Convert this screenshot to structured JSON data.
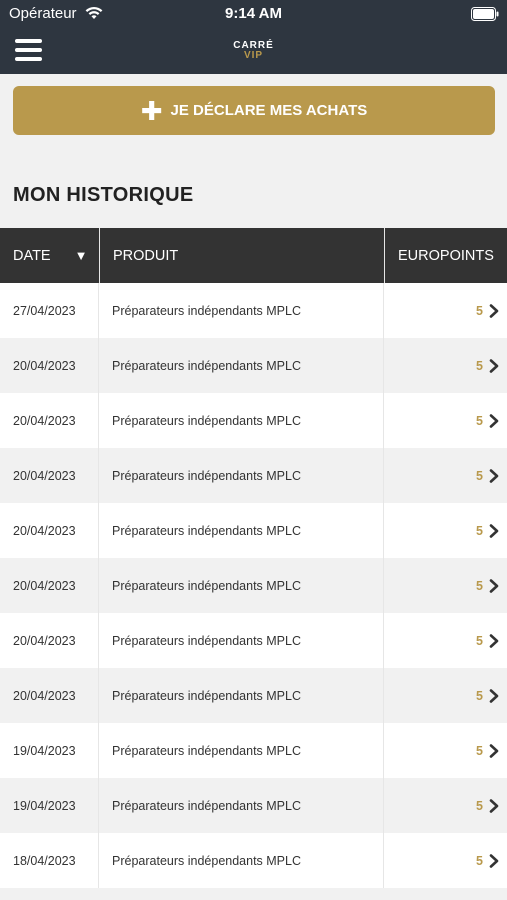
{
  "status_bar": {
    "carrier": "Opérateur",
    "time": "9:14 AM"
  },
  "header": {
    "logo_line1": "CARRÉ",
    "logo_line2": "VIP",
    "menu_icon": "hamburger-menu-icon"
  },
  "cta": {
    "icon": "plus-icon",
    "label": "JE DÉCLARE MES ACHATS"
  },
  "section_title": "MON HISTORIQUE",
  "table": {
    "columns": [
      "DATE",
      "PRODUIT",
      "EUROPOINTS"
    ],
    "sort_icon": "sort-down-triangle-icon",
    "rows": [
      {
        "date": "27/04/2023",
        "product": "Préparateurs indépendants MPLC",
        "points": "5"
      },
      {
        "date": "20/04/2023",
        "product": "Préparateurs indépendants MPLC",
        "points": "5"
      },
      {
        "date": "20/04/2023",
        "product": "Préparateurs indépendants MPLC",
        "points": "5"
      },
      {
        "date": "20/04/2023",
        "product": "Préparateurs indépendants MPLC",
        "points": "5"
      },
      {
        "date": "20/04/2023",
        "product": "Préparateurs indépendants MPLC",
        "points": "5"
      },
      {
        "date": "20/04/2023",
        "product": "Préparateurs indépendants MPLC",
        "points": "5"
      },
      {
        "date": "20/04/2023",
        "product": "Préparateurs indépendants MPLC",
        "points": "5"
      },
      {
        "date": "20/04/2023",
        "product": "Préparateurs indépendants MPLC",
        "points": "5"
      },
      {
        "date": "19/04/2023",
        "product": "Préparateurs indépendants MPLC",
        "points": "5"
      },
      {
        "date": "19/04/2023",
        "product": "Préparateurs indépendants MPLC",
        "points": "5"
      },
      {
        "date": "18/04/2023",
        "product": "Préparateurs indépendants MPLC",
        "points": "5"
      }
    ]
  },
  "colors": {
    "topbar": "#2e3640",
    "accent_gold": "#b9994c",
    "table_header": "#333333"
  }
}
